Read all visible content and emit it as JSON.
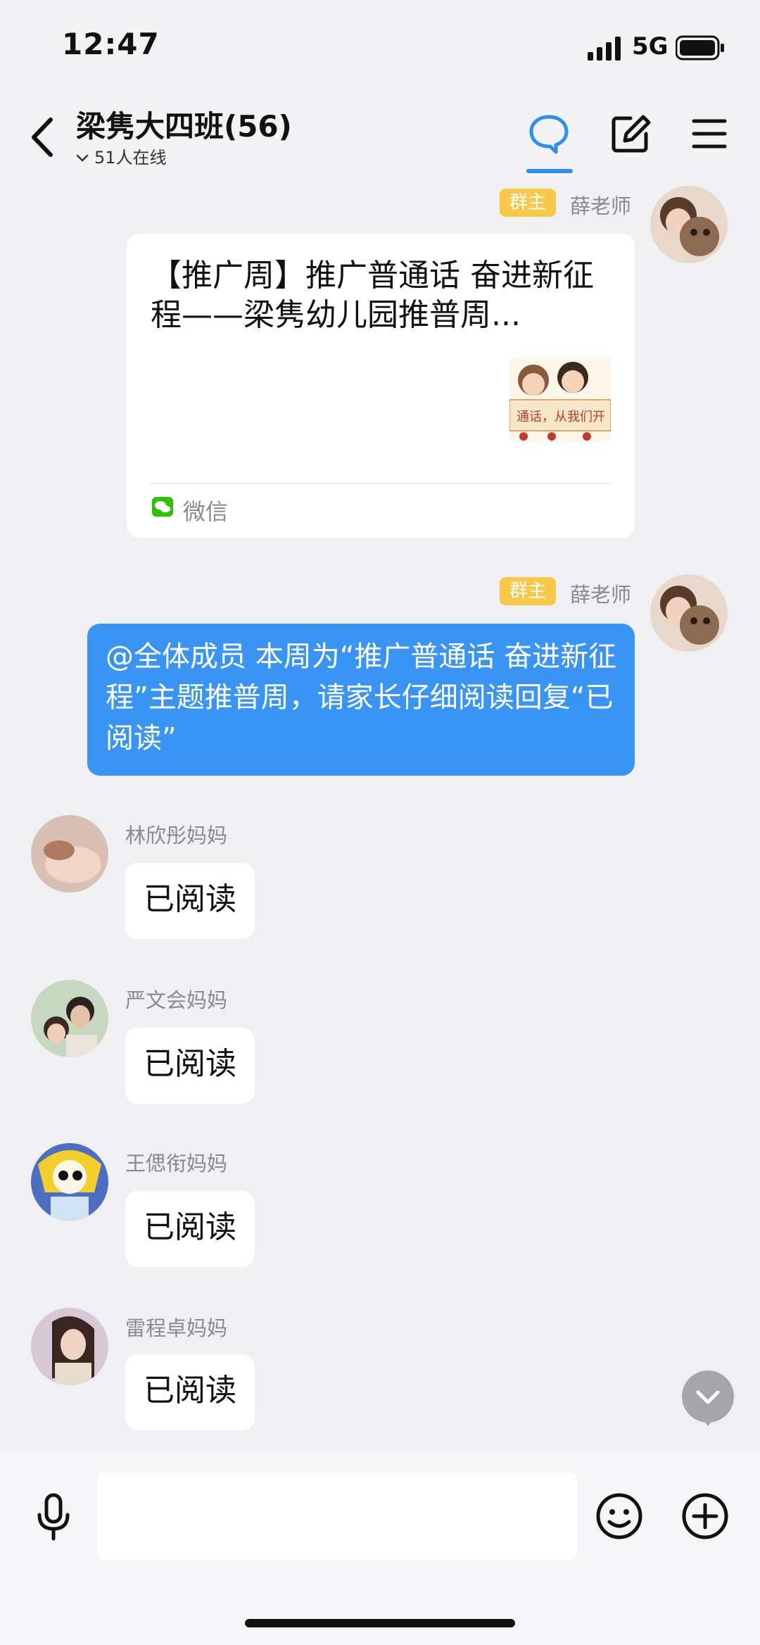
{
  "status_bar": {
    "time": "12:47",
    "network": "5G"
  },
  "header": {
    "title": "梁隽大四班(56)",
    "online": "51人在线",
    "icons": [
      "back-icon",
      "chat-bubble-icon",
      "compose-icon",
      "menu-icon"
    ]
  },
  "messages": [
    {
      "sender": "薛老师",
      "badge": "群主",
      "type": "link_card",
      "card_title": "【推广周】推广普通话 奋进新征程——梁隽幼儿园推普周...",
      "card_source": "微信"
    },
    {
      "sender": "薛老师",
      "badge": "群主",
      "type": "text",
      "text": "@全体成员 本周为“推广普通话 奋进新征程”主题推普周，请家长仔细阅读回复“已阅读”"
    },
    {
      "sender": "林欣彤妈妈",
      "type": "text",
      "text": "已阅读"
    },
    {
      "sender": "严文会妈妈",
      "type": "text",
      "text": "已阅读"
    },
    {
      "sender": "王偲衔妈妈",
      "type": "text",
      "text": "已阅读"
    },
    {
      "sender": "雷程卓妈妈",
      "type": "text",
      "text": "已阅读"
    }
  ],
  "input": {
    "placeholder": ""
  },
  "colors": {
    "accent": "#2f8ef6",
    "bubble_blue": "#3a94f3",
    "badge": "#f8c84a",
    "background": "#f0f0f2"
  }
}
